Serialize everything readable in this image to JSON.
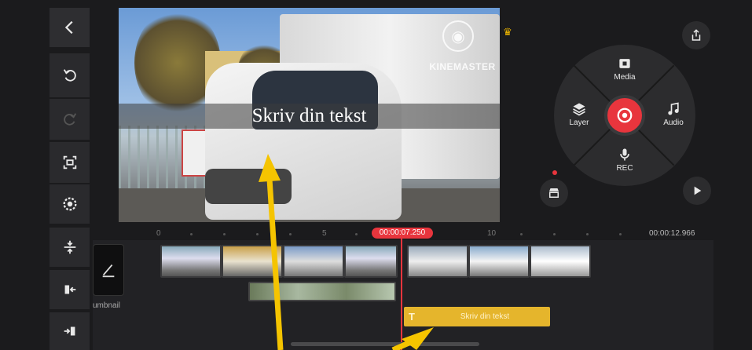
{
  "preview": {
    "overlay_text": "Skriv din tekst",
    "watermark": "KINEMASTER"
  },
  "wheel": {
    "media_label": "Media",
    "layer_label": "Layer",
    "audio_label": "Audio",
    "rec_label": "REC"
  },
  "timeline": {
    "current_time": "00:00:07.250",
    "end_time": "00:00:12.966",
    "ruler_labels": [
      "0",
      "5",
      "10"
    ],
    "thumbnail_label": "umbnail",
    "text_clip_label": "Skriv din tekst",
    "text_clip_icon": "T"
  },
  "colors": {
    "accent_red": "#e8353d",
    "text_clip_yellow": "#e5b52c",
    "annotation_yellow": "#f5c400"
  }
}
